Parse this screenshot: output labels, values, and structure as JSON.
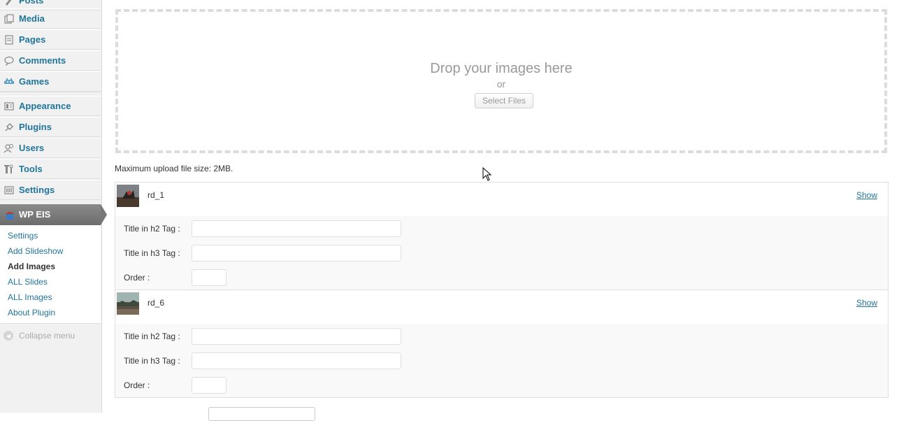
{
  "sidebar": {
    "top_partial": "Posts",
    "items": [
      {
        "label": "Media",
        "icon": "media-icon"
      },
      {
        "label": "Pages",
        "icon": "pages-icon"
      },
      {
        "label": "Comments",
        "icon": "comments-icon"
      },
      {
        "label": "Games",
        "icon": "games-icon"
      },
      {
        "label": "Appearance",
        "icon": "appearance-icon"
      },
      {
        "label": "Plugins",
        "icon": "plugins-icon"
      },
      {
        "label": "Users",
        "icon": "users-icon"
      },
      {
        "label": "Tools",
        "icon": "tools-icon"
      },
      {
        "label": "Settings",
        "icon": "settings-icon"
      }
    ],
    "active_menu": {
      "label": "WP EIS",
      "icon": "wp-eis-icon"
    },
    "submenu": [
      {
        "label": "Settings",
        "current": false
      },
      {
        "label": "Add Slideshow",
        "current": false
      },
      {
        "label": "Add Images",
        "current": true
      },
      {
        "label": "ALL Slides",
        "current": false
      },
      {
        "label": "ALL Images",
        "current": false
      },
      {
        "label": "About Plugin",
        "current": false
      }
    ],
    "collapse_label": "Collapse menu"
  },
  "uploader": {
    "drop_text": "Drop your images here",
    "or_text": "or",
    "select_button": "Select Files",
    "max_size_text": "Maximum upload file size: 2MB."
  },
  "images": [
    {
      "name": "rd_1",
      "show_label": "Show",
      "fields": [
        {
          "label": "Title in h2 Tag :",
          "value": ""
        },
        {
          "label": "Title in h3 Tag :",
          "value": ""
        },
        {
          "label": "Order :",
          "value": ""
        }
      ]
    },
    {
      "name": "rd_6",
      "show_label": "Show",
      "fields": [
        {
          "label": "Title in h2 Tag :",
          "value": ""
        },
        {
          "label": "Title in h3 Tag :",
          "value": ""
        },
        {
          "label": "Order :",
          "value": ""
        }
      ]
    }
  ],
  "colors": {
    "link": "#21759b",
    "active_menu_bg": "#777777",
    "sidebar_bg": "#f1f1f1"
  }
}
